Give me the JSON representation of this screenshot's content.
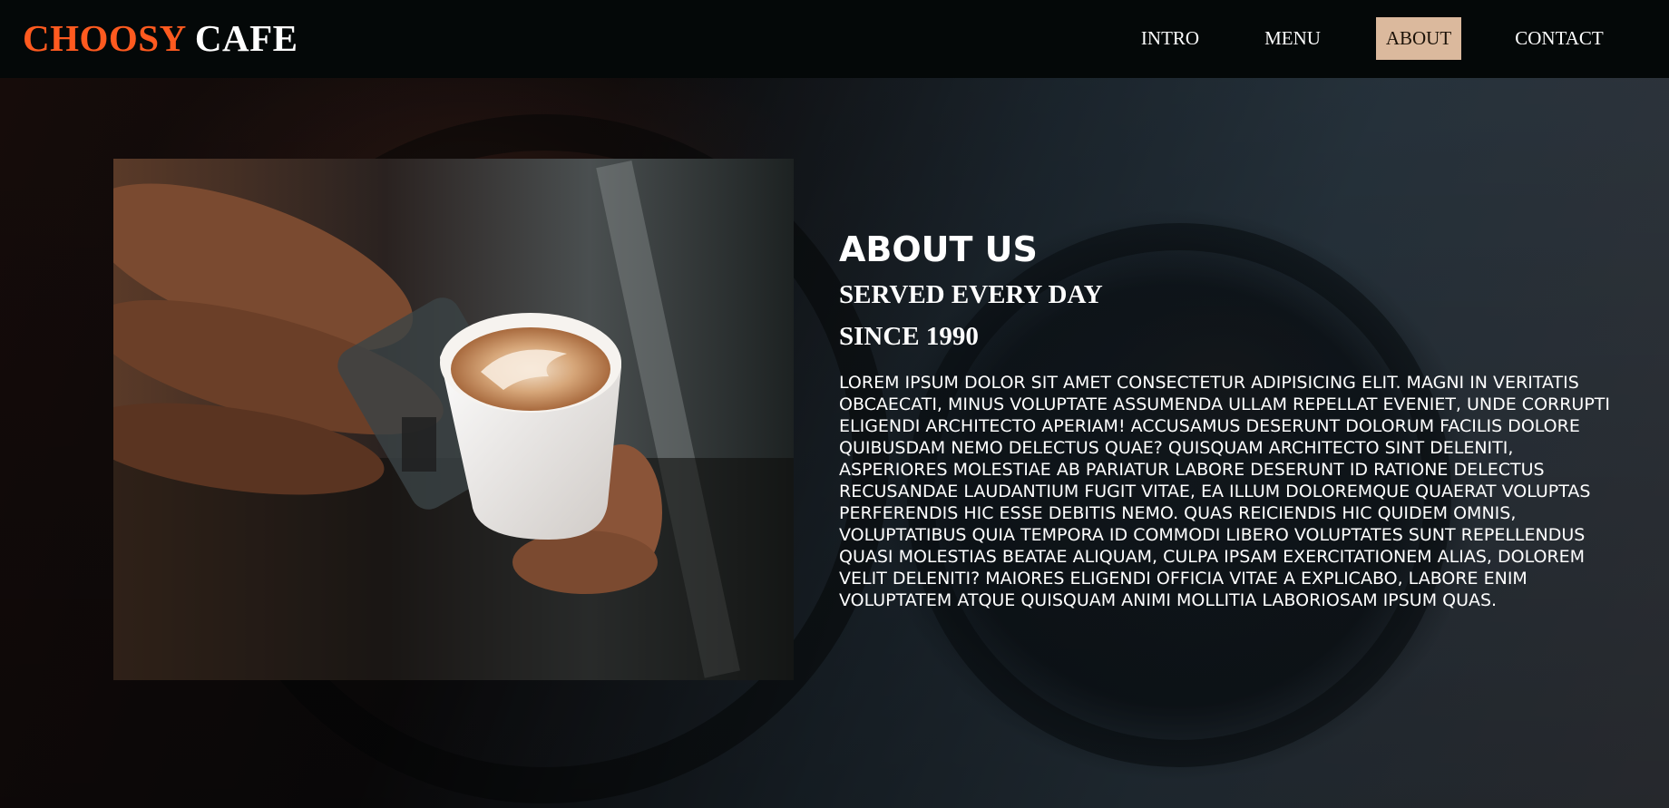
{
  "logo": {
    "accent": "CHOOSY",
    "rest": "CAFE"
  },
  "nav": {
    "items": [
      {
        "label": "INTRO"
      },
      {
        "label": "MENU"
      },
      {
        "label": "ABOUT",
        "active": true
      },
      {
        "label": "CONTACT"
      }
    ]
  },
  "about": {
    "title": "ABOUT US",
    "subtitle_line1": "SERVED EVERY DAY",
    "subtitle_line2": "SINCE 1990",
    "body": "LOREM IPSUM DOLOR SIT AMET CONSECTETUR ADIPISICING ELIT. MAGNI IN VERITATIS\nOBCAECATI, MINUS VOLUPTATE ASSUMENDA ULLAM REPELLAT EVENIET, UNDE CORRUPTI\nELIGENDI ARCHITECTO APERIAM! ACCUSAMUS DESERUNT DOLORUM FACILIS DOLORE\nQUIBUSDAM NEMO DELECTUS QUAE? QUISQUAM ARCHITECTO SINT DELENITI,\nASPERIORES MOLESTIAE AB PARIATUR LABORE DESERUNT ID RATIONE DELECTUS\nRECUSANDAE LAUDANTIUM FUGIT VITAE, EA ILLUM DOLOREMQUE QUAERAT VOLUPTAS\nPERFERENDIS HIC ESSE DEBITIS NEMO. QUAS REICIENDIS HIC QUIDEM OMNIS,\nVOLUPTATIBUS QUIA TEMPORA ID COMMODI LIBERO VOLUPTATES SUNT REPELLENDUS\nQUASI MOLESTIAS BEATAE ALIQUAM, CULPA IPSAM EXERCITATIONEM ALIAS, DOLOREM\nVELIT DELENITI? MAIORES ELIGENDI OFFICIA VITAE A EXPLICABO, LABORE ENIM\nVOLUPTATEM ATQUE QUISQUAM ANIMI MOLLITIA LABORIOSAM IPSUM QUAS."
  },
  "colors": {
    "logo_accent": "#ff5a1f",
    "nav_active_bg": "#dbb99d",
    "navbar_bg": "#040808"
  },
  "images": {
    "hero_background": "coffee-cup-saucer-photo",
    "about_photo": "latte-art-pour-photo"
  }
}
